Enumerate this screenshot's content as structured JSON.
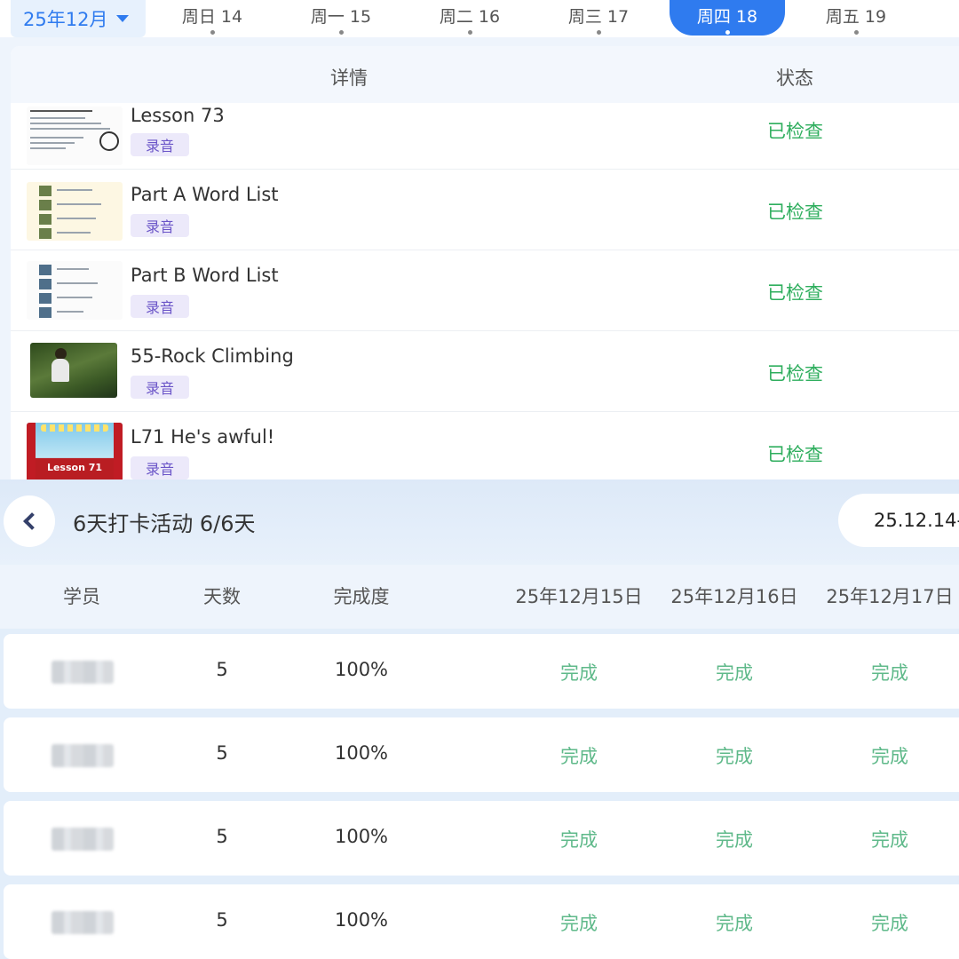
{
  "week_bar": {
    "month_label": "25年12月",
    "days": [
      {
        "label": "周日 14",
        "active": false
      },
      {
        "label": "周一 15",
        "active": false
      },
      {
        "label": "周二 16",
        "active": false
      },
      {
        "label": "周三 17",
        "active": false
      },
      {
        "label": "周四 18",
        "active": true
      },
      {
        "label": "周五 19",
        "active": false
      }
    ]
  },
  "detail_table": {
    "headers": {
      "detail": "详情",
      "status": "状态"
    },
    "tasks": [
      {
        "title": "Lesson 73",
        "tag": "录音",
        "status": "已检查",
        "thumb": "doc"
      },
      {
        "title": "Part A Word List",
        "tag": "录音",
        "status": "已检查",
        "thumb": "cream"
      },
      {
        "title": "Part B Word List",
        "tag": "录音",
        "status": "已检查",
        "thumb": "doc"
      },
      {
        "title": "55-Rock Climbing",
        "tag": "录音",
        "status": "已检查",
        "thumb": "photo"
      },
      {
        "title": "L71 He's awful!",
        "tag": "录音",
        "status": "已检查",
        "thumb": "stage",
        "thumb_text": "Lesson 71"
      }
    ]
  },
  "activity": {
    "title": "6天打卡活动 6/6天",
    "date_range": "25.12.14-",
    "columns": [
      "学员",
      "天数",
      "完成度",
      "25年12月15日",
      "25年12月16日",
      "25年12月17日"
    ],
    "rows": [
      {
        "days": "5",
        "completion": "100%",
        "d15": "完成",
        "d16": "完成",
        "d17": "完成"
      },
      {
        "days": "5",
        "completion": "100%",
        "d15": "完成",
        "d16": "完成",
        "d17": "完成"
      },
      {
        "days": "5",
        "completion": "100%",
        "d15": "完成",
        "d16": "完成",
        "d17": "完成"
      },
      {
        "days": "5",
        "completion": "100%",
        "d15": "完成",
        "d16": "完成",
        "d17": "完成"
      }
    ]
  },
  "colors": {
    "accent": "#2f7bef",
    "checked_green": "#2fae5e",
    "done_green": "#5fb98a",
    "tag_bg": "#ece9fa",
    "tag_text": "#6b55c8"
  }
}
